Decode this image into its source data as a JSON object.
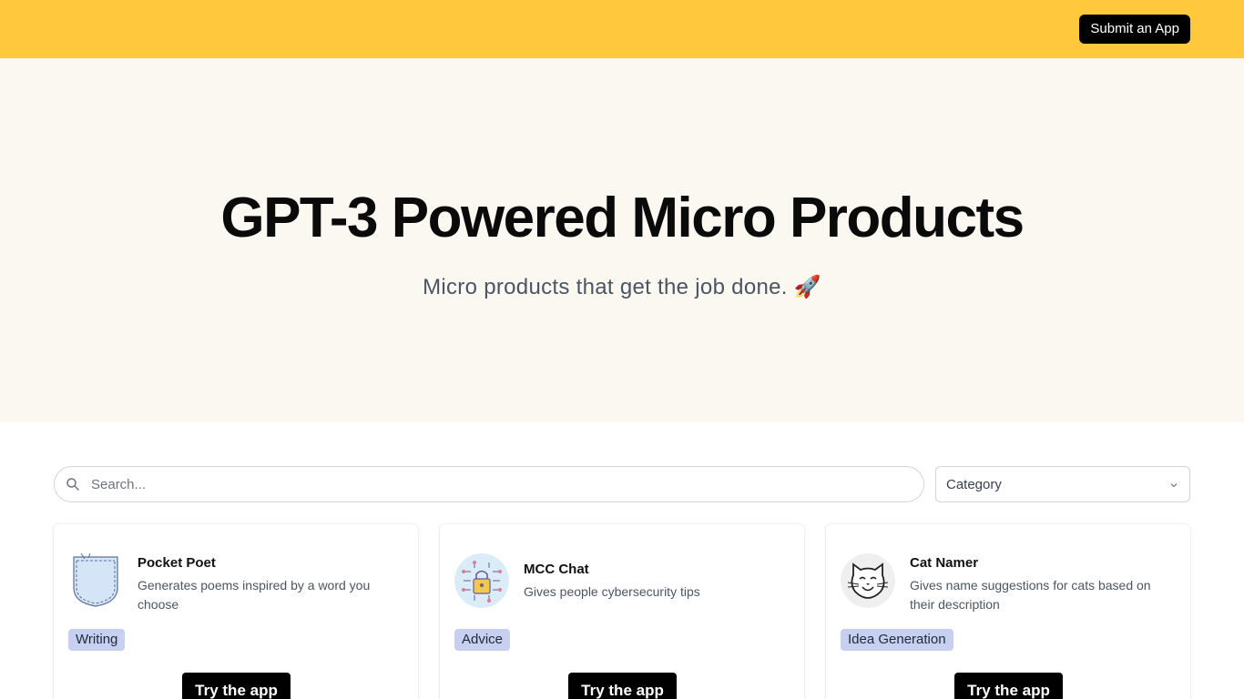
{
  "header": {
    "submit_label": "Submit an App",
    "background": "#ffc83d"
  },
  "hero": {
    "title": "GPT-3 Powered Micro Products",
    "subtitle": "Micro products that get the job done. 🚀"
  },
  "search": {
    "placeholder": "Search...",
    "icon": "search-icon"
  },
  "category": {
    "label": "Category",
    "icon": "chevron-down-icon"
  },
  "cards": [
    {
      "title": "Pocket Poet",
      "description": "Generates poems inspired by a word you choose",
      "tag": "Writing",
      "icon": "pocket-icon",
      "cta": "Try the app"
    },
    {
      "title": "MCC Chat",
      "description": "Gives people cybersecurity tips",
      "tag": "Advice",
      "icon": "lock-circuit-icon",
      "cta": "Try the app"
    },
    {
      "title": "Cat Namer",
      "description": "Gives name suggestions for cats based on their description",
      "tag": "Idea Generation",
      "icon": "cat-icon",
      "cta": "Try the app"
    }
  ]
}
